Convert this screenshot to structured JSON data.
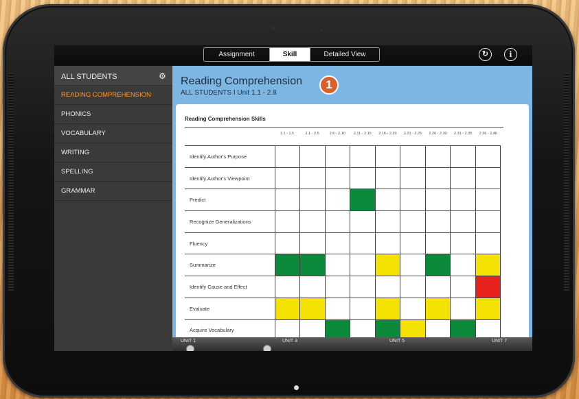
{
  "toolbar": {
    "tabs": [
      "Assignment",
      "Skill",
      "Detailed View"
    ],
    "active_tab": "Skill",
    "refresh_icon": "refresh-icon",
    "info_icon": "info-icon"
  },
  "sidebar": {
    "header": "ALL STUDENTS",
    "items": [
      {
        "label": "READING COMPREHENSION",
        "active": true
      },
      {
        "label": "PHONICS"
      },
      {
        "label": "VOCABULARY"
      },
      {
        "label": "WRITING"
      },
      {
        "label": "SPELLING"
      },
      {
        "label": "GRAMMAR"
      }
    ],
    "active_color": "#ff9a2a"
  },
  "main": {
    "title": "Reading Comprehension",
    "subtitle": "ALL STUDENTS I Unit 1.1 - 2.8",
    "badge": "1",
    "card_title": "Reading Comprehension Skills",
    "columns": [
      "1.1 - 1.5",
      "2.1 - 2.5",
      "2.6 - 2.10",
      "2.11 - 2.15",
      "2.16 - 2.20",
      "2.21 - 2.25",
      "2.26 - 2.30",
      "2.31 - 2.35",
      "2.36 - 2.40"
    ],
    "rows": [
      {
        "label": "Identify Author's Purpose",
        "cells": [
          "",
          "",
          "",
          "",
          "",
          "",
          "",
          "",
          ""
        ]
      },
      {
        "label": "Identify Author's Viewpoint",
        "cells": [
          "",
          "",
          "",
          "",
          "",
          "",
          "",
          "",
          ""
        ]
      },
      {
        "label": "Predict",
        "cells": [
          "",
          "",
          "",
          "g",
          "",
          "",
          "",
          "",
          ""
        ]
      },
      {
        "label": "Recognize Generalizations",
        "cells": [
          "",
          "",
          "",
          "",
          "",
          "",
          "",
          "",
          ""
        ]
      },
      {
        "label": "Fluency",
        "cells": [
          "",
          "",
          "",
          "",
          "",
          "",
          "",
          "",
          ""
        ]
      },
      {
        "label": "Summarize",
        "cells": [
          "g",
          "g",
          "",
          "",
          "y",
          "",
          "g",
          "",
          "y"
        ]
      },
      {
        "label": "Identify Cause and Effect",
        "cells": [
          "",
          "",
          "",
          "",
          "",
          "",
          "",
          "",
          "r"
        ]
      },
      {
        "label": "Evaluate",
        "cells": [
          "y",
          "y",
          "",
          "",
          "y",
          "",
          "y",
          "",
          "y"
        ]
      },
      {
        "label": "Acquire Vocabulary",
        "cells": [
          "",
          "",
          "g",
          "",
          "g",
          "y",
          "",
          "g",
          ""
        ]
      }
    ],
    "status_colors": {
      "g": "#0b8a3c",
      "y": "#f4e204",
      "r": "#e8231f"
    }
  },
  "timeline": {
    "units": [
      "UNIT 1",
      "UNIT 3",
      "UNIT 5",
      "UNIT 7"
    ]
  }
}
